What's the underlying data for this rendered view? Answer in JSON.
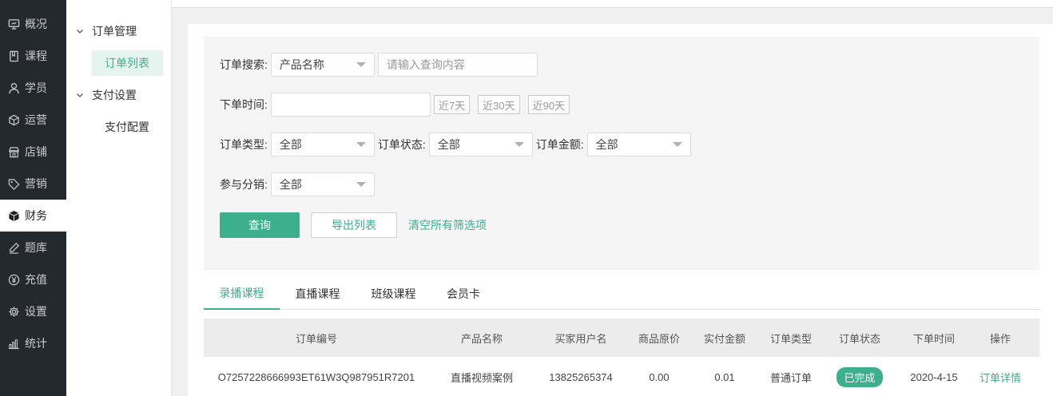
{
  "nav": {
    "items": [
      {
        "label": "概况",
        "icon": "monitor-icon"
      },
      {
        "label": "课程",
        "icon": "book-icon"
      },
      {
        "label": "学员",
        "icon": "user-icon"
      },
      {
        "label": "运营",
        "icon": "cube-icon"
      },
      {
        "label": "店铺",
        "icon": "store-icon"
      },
      {
        "label": "营销",
        "icon": "tag-icon"
      },
      {
        "label": "财务",
        "icon": "box-icon",
        "active": true
      },
      {
        "label": "题库",
        "icon": "pen-icon"
      },
      {
        "label": "充值",
        "icon": "yen-icon"
      },
      {
        "label": "设置",
        "icon": "gear-icon"
      },
      {
        "label": "统计",
        "icon": "bar-chart-icon"
      }
    ]
  },
  "submenu": {
    "groups": [
      {
        "label": "订单管理",
        "children": [
          {
            "label": "订单列表",
            "active": true
          }
        ]
      },
      {
        "label": "支付设置",
        "children": [
          {
            "label": "支付配置"
          }
        ]
      }
    ]
  },
  "filter": {
    "search_label": "订单搜索:",
    "search_field_select": "产品名称",
    "search_placeholder": "请输入查询内容",
    "time_label": "下单时间:",
    "time_value": "",
    "quick_ranges": [
      "近7天",
      "近30天",
      "近90天"
    ],
    "order_type_label": "订单类型:",
    "order_type_value": "全部",
    "order_status_label": "订单状态:",
    "order_status_value": "全部",
    "order_amount_label": "订单金额:",
    "order_amount_value": "全部",
    "distribution_label": "参与分销:",
    "distribution_value": "全部",
    "query_button": "查询",
    "export_button": "导出列表",
    "clear_link": "清空所有筛选项"
  },
  "tabs": [
    "录播课程",
    "直播课程",
    "班级课程",
    "会员卡"
  ],
  "active_tab": 0,
  "table": {
    "columns": [
      "订单编号",
      "产品名称",
      "买家用户名",
      "商品原价",
      "实付金额",
      "订单类型",
      "订单状态",
      "下单时间",
      "操作"
    ],
    "rows": [
      {
        "order_no": "O7257228666993ET61W3Q987951R7201",
        "product": "直播视频案例",
        "buyer": "13825265374",
        "original_price": "0.00",
        "paid": "0.01",
        "type": "普通订单",
        "status": "已完成",
        "time": "2020-4-15",
        "action": "订单详情"
      }
    ]
  },
  "colors": {
    "accent": "#3eaf8c",
    "nav_bg": "#24292e"
  }
}
